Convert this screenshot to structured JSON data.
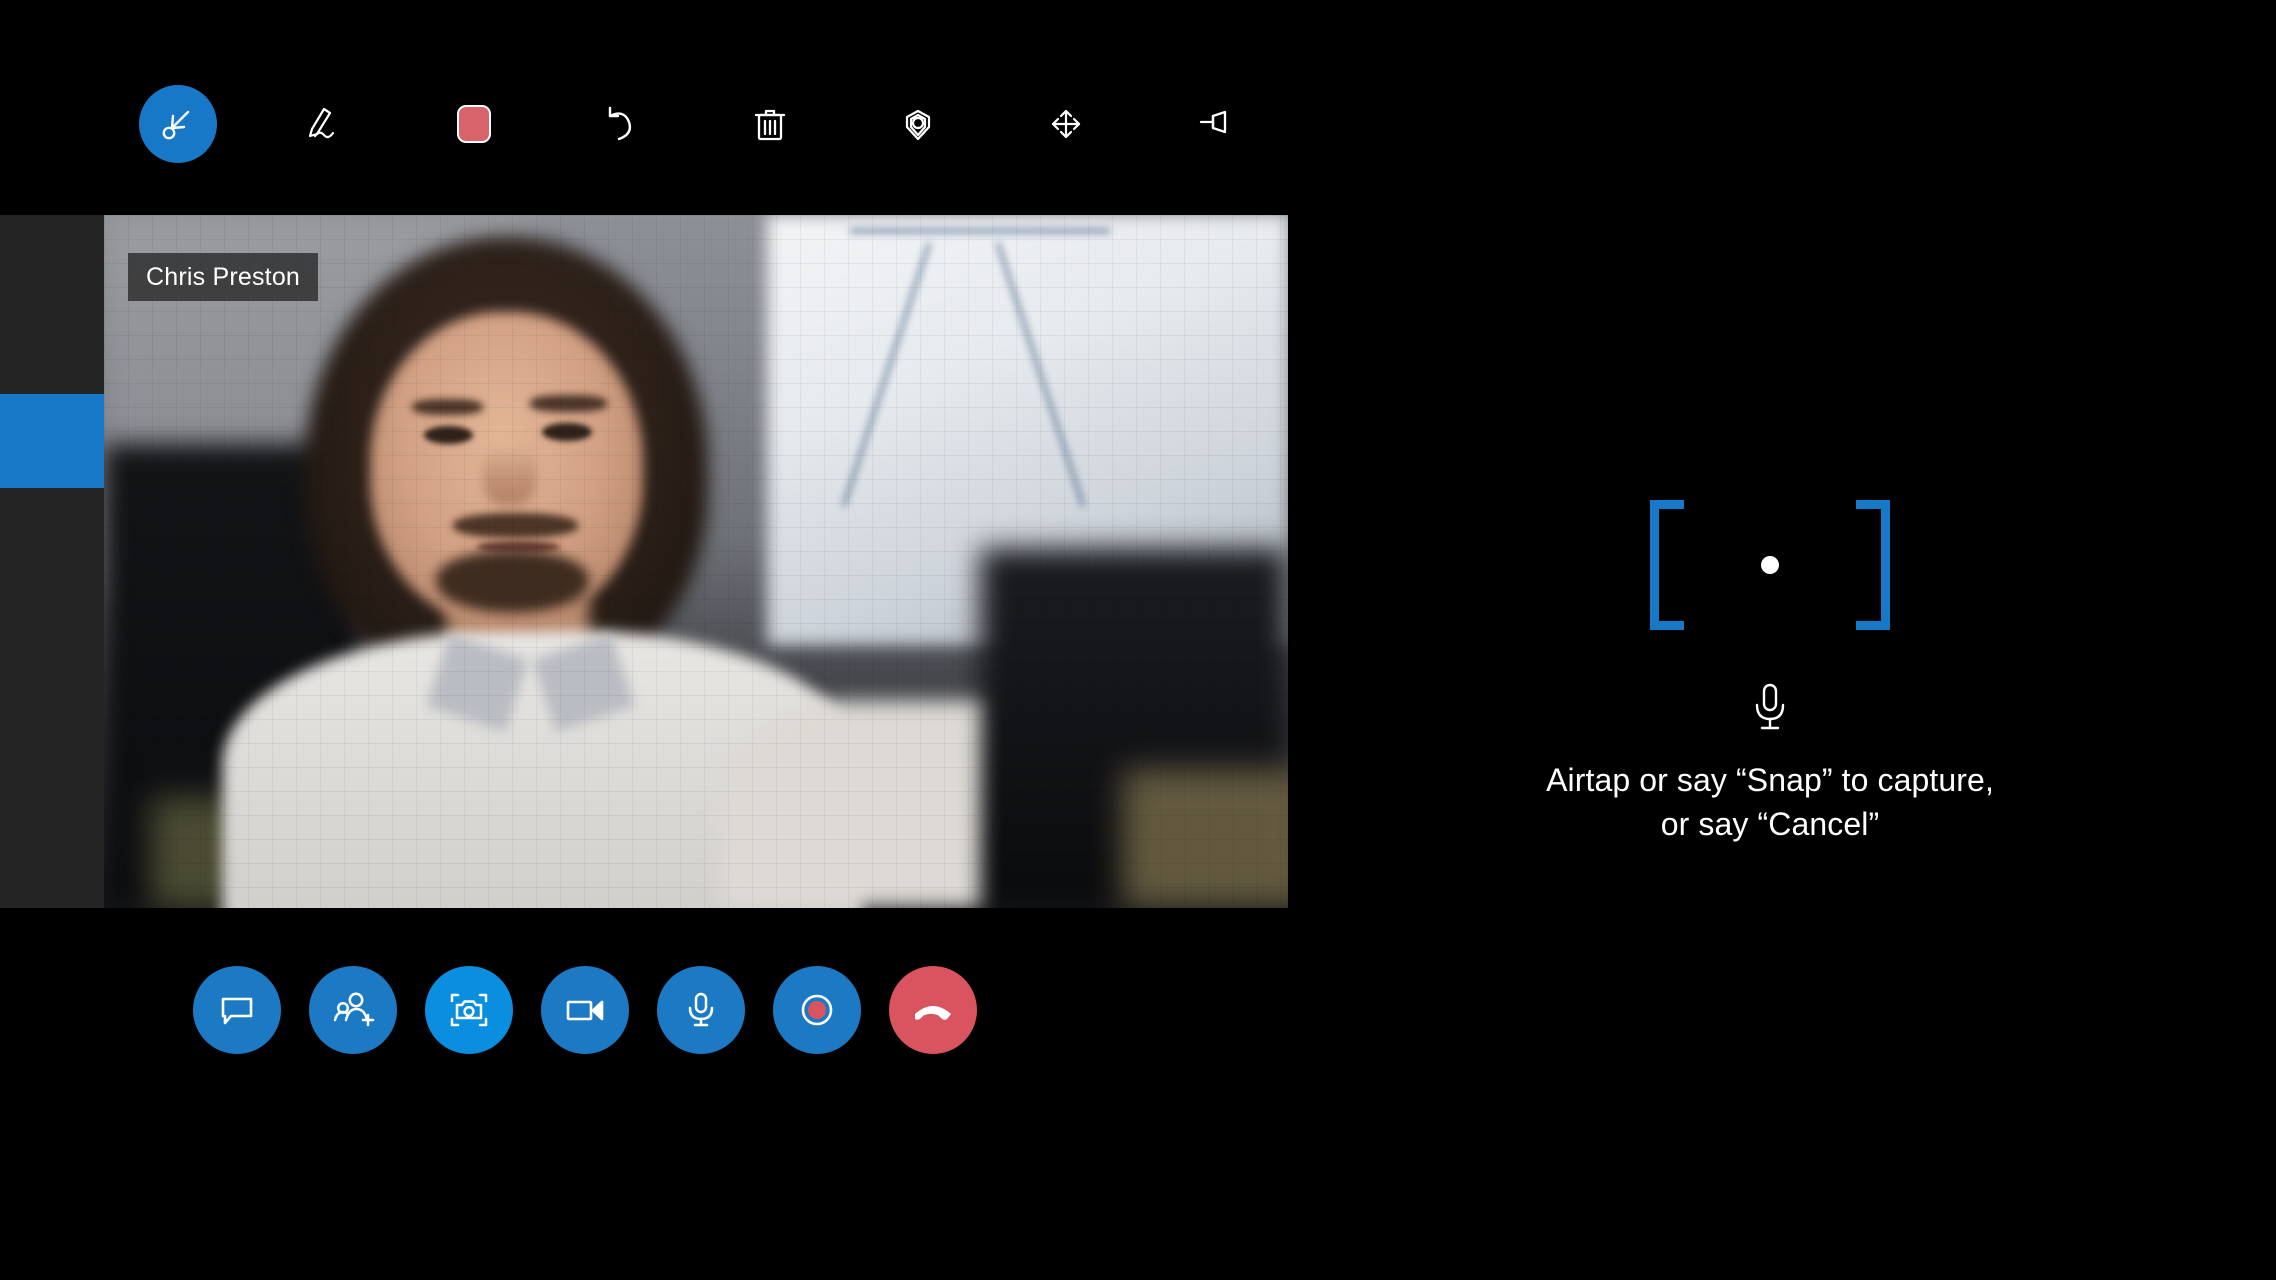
{
  "app": {
    "background_color": "#000000",
    "accent_blue": "#1778c8",
    "accent_bright_blue": "#0a8fe0",
    "accent_red": "#d9545e",
    "rail_color": "#242424"
  },
  "left_rail": {
    "name": "participant-rail",
    "scroll_indicator_color": "#1778c8"
  },
  "annotation_toolbar": {
    "items": [
      {
        "name": "select-cursor-tool",
        "icon": "cursor-select-icon",
        "active": true,
        "label": "Select"
      },
      {
        "name": "ink-pen-tool",
        "icon": "pen-ink-icon",
        "active": false,
        "label": "Ink"
      },
      {
        "name": "color-swatch",
        "icon": "color-swatch-icon",
        "active": false,
        "label": "Color",
        "color": "#d9636b"
      },
      {
        "name": "undo-tool",
        "icon": "undo-arrow-icon",
        "active": false,
        "label": "Undo"
      },
      {
        "name": "delete-tool",
        "icon": "trash-icon",
        "active": false,
        "label": "Delete"
      },
      {
        "name": "place-anchor-tool",
        "icon": "location-pin-icon",
        "active": false,
        "label": "Anchor"
      },
      {
        "name": "move-tool",
        "icon": "move-arrows-icon",
        "active": false,
        "label": "Move"
      },
      {
        "name": "pin-tool",
        "icon": "pushpin-icon",
        "active": false,
        "label": "Pin"
      }
    ]
  },
  "video": {
    "participant_name": "Chris Preston"
  },
  "call_controls": {
    "buttons": [
      {
        "name": "chat-button",
        "icon": "chat-bubble-icon",
        "style": "blue",
        "label": "Chat"
      },
      {
        "name": "add-people-button",
        "icon": "add-person-icon",
        "style": "blue",
        "label": "Add people"
      },
      {
        "name": "capture-photo-button",
        "icon": "camera-icon",
        "style": "bright",
        "label": "Capture photo"
      },
      {
        "name": "video-toggle-button",
        "icon": "video-camera-icon",
        "style": "blue",
        "label": "Video"
      },
      {
        "name": "mic-toggle-button",
        "icon": "microphone-icon",
        "style": "blue",
        "label": "Microphone"
      },
      {
        "name": "record-button",
        "icon": "record-dot-icon",
        "style": "blue",
        "label": "Record"
      },
      {
        "name": "end-call-button",
        "icon": "hangup-phone-icon",
        "style": "red",
        "label": "End call"
      }
    ]
  },
  "capture_hud": {
    "cursor_icon": "cursor-dot-icon",
    "mic_icon": "microphone-icon",
    "instruction_line_1": "Airtap or say “Snap” to capture,",
    "instruction_line_2": "or say “Cancel”"
  }
}
